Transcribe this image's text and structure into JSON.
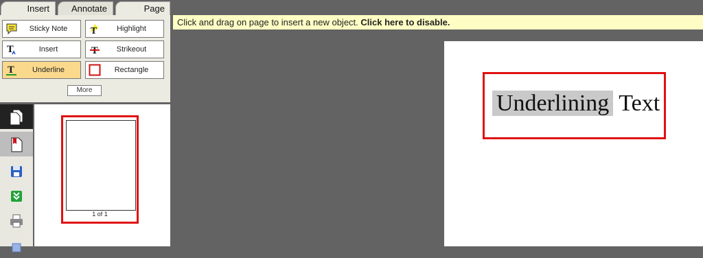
{
  "tabs": {
    "insert": "Insert",
    "annotate": "Annotate",
    "page": "Page"
  },
  "tools": {
    "sticky_note": {
      "label": "Sticky Note",
      "icon": "sticky-note-icon"
    },
    "highlight": {
      "label": "Highlight",
      "icon": "highlight-icon"
    },
    "insert": {
      "label": "Insert",
      "icon": "insert-text-icon"
    },
    "strikeout": {
      "label": "Strikeout",
      "icon": "strikeout-icon"
    },
    "underline": {
      "label": "Underline",
      "icon": "underline-icon",
      "selected": true
    },
    "rectangle": {
      "label": "Rectangle",
      "icon": "rectangle-icon"
    },
    "more": "More"
  },
  "sidebar_icons": [
    "pages-icon",
    "bookmark-pages-icon",
    "save-icon",
    "download-icon",
    "print-icon",
    "more-icon"
  ],
  "thumbnail": {
    "label": "1 of 1"
  },
  "notice": {
    "text": "Click and drag on page to insert a new object.",
    "action": "Click here to disable."
  },
  "document": {
    "underlined": "Underlining",
    "rest": "Text"
  },
  "colors": {
    "selected_tool": "#fbd98c",
    "notice_bg": "#fdfdc4",
    "annotation_border": "#e01010",
    "underline_highlight": "#c9c9c9"
  }
}
